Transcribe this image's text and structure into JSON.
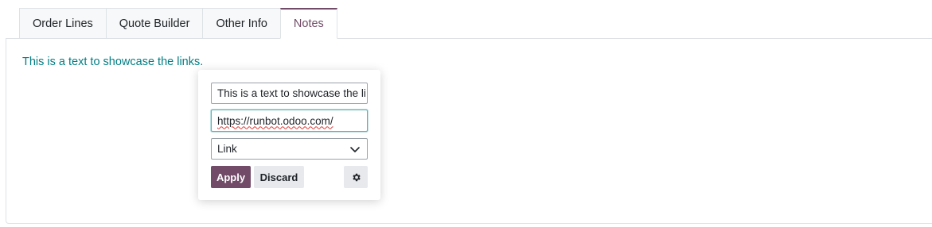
{
  "tabs": [
    {
      "label": "Order Lines",
      "active": false
    },
    {
      "label": "Quote Builder",
      "active": false
    },
    {
      "label": "Other Info",
      "active": false
    },
    {
      "label": "Notes",
      "active": true
    }
  ],
  "notes": {
    "text": "This is a text to showcase the links."
  },
  "link_popover": {
    "label_value": "This is a text to showcase the li",
    "url_value": "https://runbot.odoo.com/",
    "type_selected": "Link",
    "apply_label": "Apply",
    "discard_label": "Discard",
    "settings_icon": "gear-icon",
    "dropdown_icon": "chevron-down-icon"
  },
  "colors": {
    "accent": "#714b67",
    "link_text": "#017e84",
    "focus_border": "#5fb0b4"
  }
}
